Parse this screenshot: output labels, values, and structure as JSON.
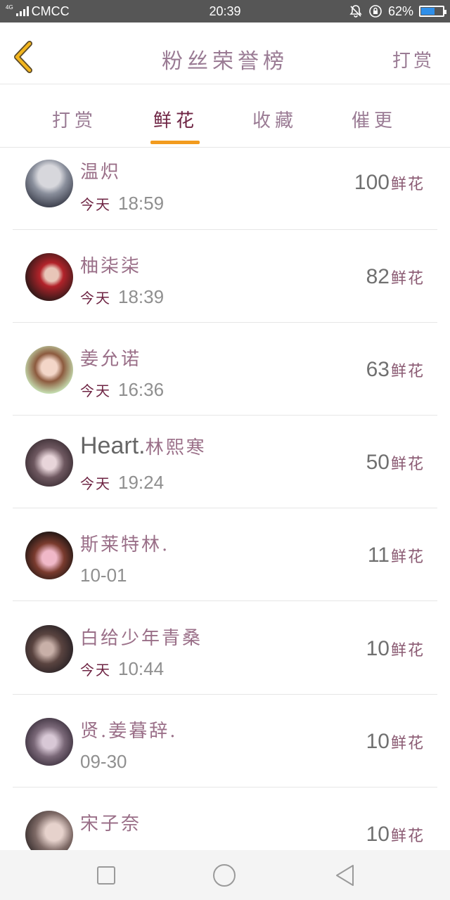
{
  "status_bar": {
    "network": "4G",
    "carrier": "CMCC",
    "time": "20:39",
    "battery_percent": "62%",
    "battery_level": 0.62,
    "battery_color": "#2f8fe9"
  },
  "header": {
    "title": "粉丝荣誉榜",
    "right_action": "打赏",
    "back_icon": "chevron-left-icon",
    "accent": "#f2b51e"
  },
  "tabs": {
    "items": [
      {
        "label": "打赏"
      },
      {
        "label": "鲜花"
      },
      {
        "label": "收藏"
      },
      {
        "label": "催更"
      }
    ],
    "active_index": 1,
    "indicator_color": "#f29b1e"
  },
  "list": {
    "unit": "鲜花",
    "rows": [
      {
        "name_cn": "温炽",
        "name_lat": "",
        "day": "今天",
        "time": "18:59",
        "amount": "100"
      },
      {
        "name_cn": "柚柒柒",
        "name_lat": "",
        "day": "今天",
        "time": "18:39",
        "amount": "82"
      },
      {
        "name_cn": "姜允诺",
        "name_lat": "",
        "day": "今天",
        "time": "16:36",
        "amount": "63"
      },
      {
        "name_cn": "林熙寒",
        "name_lat": "Heart.",
        "day": "今天",
        "time": "19:24",
        "amount": "50"
      },
      {
        "name_cn": "斯莱特林.",
        "name_lat": "",
        "day": "",
        "time": "10-01",
        "amount": "11"
      },
      {
        "name_cn": "白给少年青桑",
        "name_lat": "",
        "day": "今天",
        "time": "10:44",
        "amount": "10"
      },
      {
        "name_cn": "贤.姜暮辞.",
        "name_lat": "",
        "day": "",
        "time": "09-30",
        "amount": "10"
      },
      {
        "name_cn": "宋子奈",
        "name_lat": "",
        "day": "",
        "time": "",
        "amount": "10"
      }
    ]
  },
  "nav_bar": {
    "items": [
      "square-icon",
      "circle-icon",
      "triangle-back-icon"
    ]
  }
}
